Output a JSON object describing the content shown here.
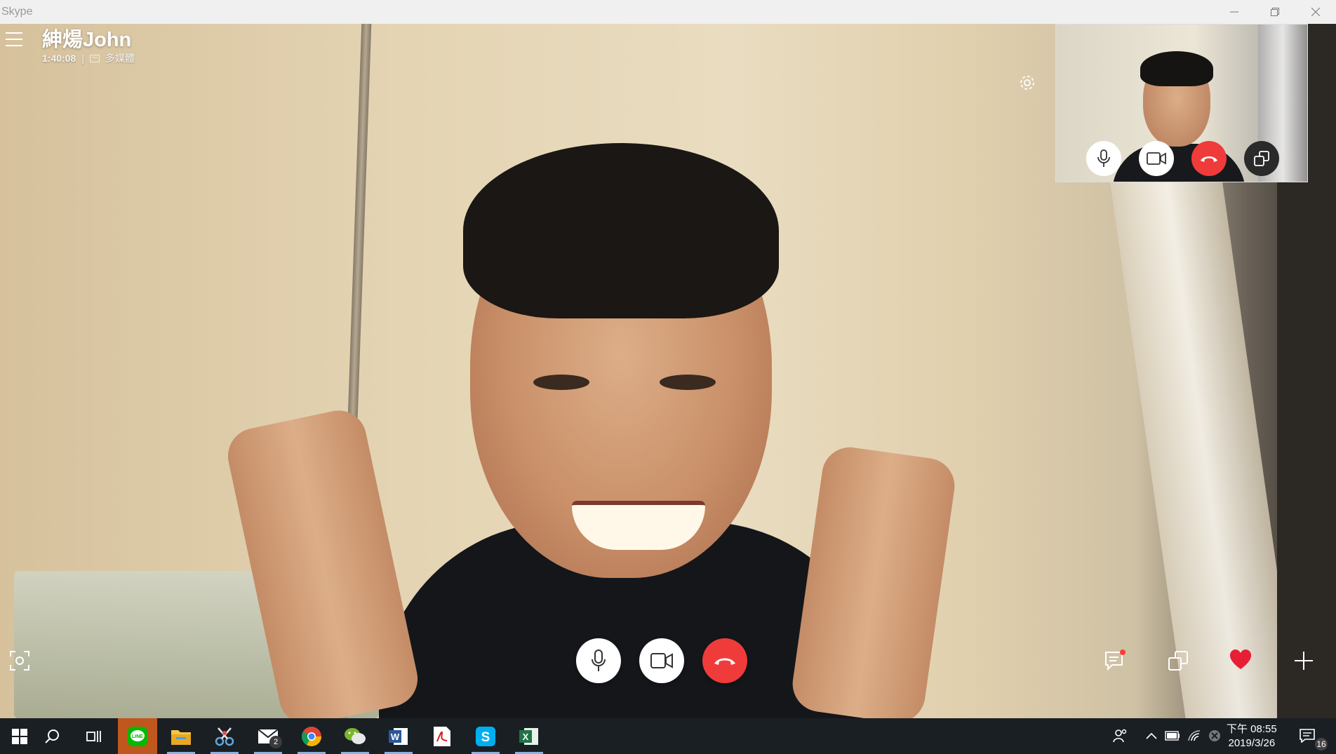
{
  "window": {
    "title": "Skype",
    "controls": [
      "minimize",
      "restore",
      "close"
    ]
  },
  "call": {
    "contact_name": "紳煬John",
    "duration": "1:40:08",
    "separator": "|",
    "media_label": "多媒體",
    "media_icon": "media-card-icon"
  },
  "self_preview": {
    "controls": [
      "mic-icon",
      "video-camera-icon",
      "hang-up-icon",
      "switch-view-icon"
    ]
  },
  "main_controls": [
    "mic-icon",
    "video-camera-icon",
    "hang-up-icon"
  ],
  "side_tools": {
    "left": [
      "snapshot-icon"
    ],
    "right": [
      "chat-icon",
      "switch-view-icon",
      "heart-icon",
      "plus-icon"
    ],
    "chat_has_notification": true
  },
  "colors": {
    "hang_up": "#f03b3b",
    "heart": "#e81e35",
    "taskbar": "#1a1f24",
    "active_task": "#c0571e",
    "notification_dot": "#ff3b3b"
  },
  "taskbar": {
    "apps": [
      {
        "name": "LINE",
        "icon": "line-icon",
        "active": true
      },
      {
        "name": "File Explorer",
        "icon": "folder-icon",
        "running": true
      },
      {
        "name": "Snipping Tool",
        "icon": "scissors-icon",
        "running": true
      },
      {
        "name": "Mail",
        "icon": "mail-icon",
        "badge": "2",
        "running": true
      },
      {
        "name": "Chrome",
        "icon": "chrome-icon",
        "running": true
      },
      {
        "name": "WeChat",
        "icon": "wechat-icon",
        "running": true
      },
      {
        "name": "Word",
        "icon": "word-icon",
        "running": true
      },
      {
        "name": "Acrobat",
        "icon": "pdf-icon",
        "running": false
      },
      {
        "name": "Skype",
        "icon": "skype-icon",
        "running": true
      },
      {
        "name": "Excel",
        "icon": "excel-icon",
        "running": true
      }
    ],
    "time": "下午 08:55",
    "date": "2019/3/26",
    "notification_count": "16"
  }
}
